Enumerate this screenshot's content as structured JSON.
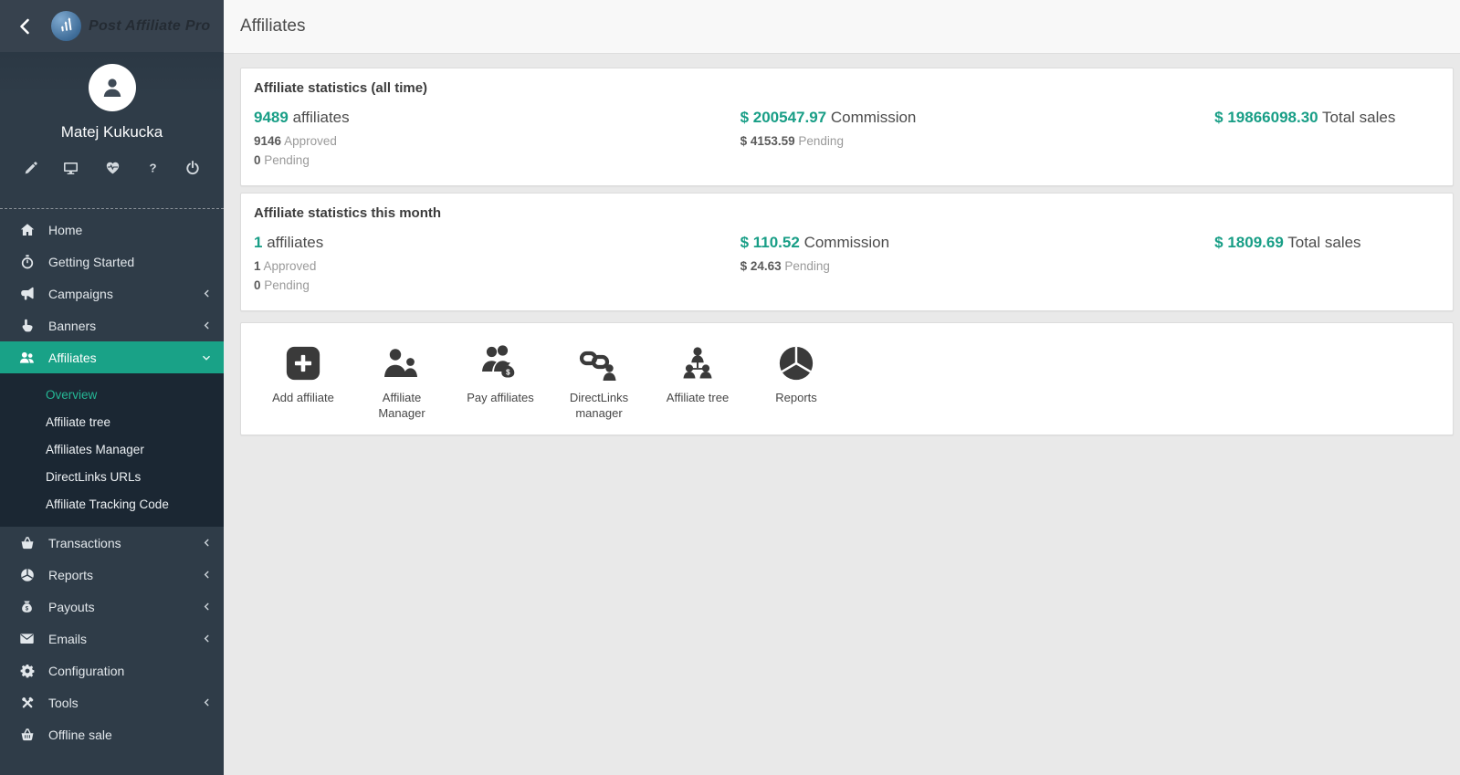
{
  "app": {
    "brand": "Post Affiliate Pro"
  },
  "colors": {
    "accent_teal": "#189e86",
    "active_menu_green": "#19a287",
    "sidebar_bg": "#2f3c48",
    "submenu_bg": "#1b2733",
    "body_bg": "#e9e9e9"
  },
  "sidebar": {
    "user": {
      "name": "Matej Kukucka"
    },
    "quick_icons": [
      "pencil",
      "monitor",
      "heartbeat",
      "help",
      "power"
    ],
    "menu": [
      {
        "label": "Home",
        "icon": "home"
      },
      {
        "label": "Getting Started",
        "icon": "stopwatch"
      },
      {
        "label": "Campaigns",
        "icon": "megaphone",
        "chevron": "left"
      },
      {
        "label": "Banners",
        "icon": "hand-pointer",
        "chevron": "left"
      },
      {
        "label": "Affiliates",
        "icon": "users",
        "chevron": "down",
        "active": true
      },
      {
        "label": "Transactions",
        "icon": "basket",
        "chevron": "left"
      },
      {
        "label": "Reports",
        "icon": "pie-chart",
        "chevron": "left"
      },
      {
        "label": "Payouts",
        "icon": "money-bag",
        "chevron": "left"
      },
      {
        "label": "Emails",
        "icon": "envelope",
        "chevron": "left"
      },
      {
        "label": "Configuration",
        "icon": "gear"
      },
      {
        "label": "Tools",
        "icon": "tools",
        "chevron": "left"
      },
      {
        "label": "Offline sale",
        "icon": "cart"
      }
    ],
    "affiliates_submenu": [
      {
        "label": "Overview",
        "active": true
      },
      {
        "label": "Affiliate tree"
      },
      {
        "label": "Affiliates Manager"
      },
      {
        "label": "DirectLinks URLs"
      },
      {
        "label": "Affiliate Tracking Code"
      }
    ]
  },
  "header": {
    "title": "Affiliates"
  },
  "cards": {
    "all_time": {
      "title": "Affiliate statistics (all time)",
      "affiliates": {
        "value": "9489",
        "label": "affiliates",
        "approved_value": "9146",
        "approved_label": "Approved",
        "pending_value": "0",
        "pending_label": "Pending"
      },
      "commission": {
        "value": "$ 200547.97",
        "label": "Commission",
        "pending_value": "$ 4153.59",
        "pending_label": "Pending"
      },
      "total_sales": {
        "value": "$ 19866098.30",
        "label": "Total sales"
      }
    },
    "this_month": {
      "title": "Affiliate statistics this month",
      "affiliates": {
        "value": "1",
        "label": "affiliates",
        "approved_value": "1",
        "approved_label": "Approved",
        "pending_value": "0",
        "pending_label": "Pending"
      },
      "commission": {
        "value": "$ 110.52",
        "label": "Commission",
        "pending_value": "$ 24.63",
        "pending_label": "Pending"
      },
      "total_sales": {
        "value": "$ 1809.69",
        "label": "Total sales"
      }
    }
  },
  "shortcuts": [
    {
      "label": "Add affiliate",
      "icon": "add-affiliate"
    },
    {
      "label": "Affiliate Manager",
      "icon": "affiliate-manager"
    },
    {
      "label": "Pay affiliates",
      "icon": "pay-affiliates"
    },
    {
      "label": "DirectLinks manager",
      "icon": "directlinks-manager"
    },
    {
      "label": "Affiliate tree",
      "icon": "affiliate-tree"
    },
    {
      "label": "Reports",
      "icon": "reports"
    }
  ]
}
